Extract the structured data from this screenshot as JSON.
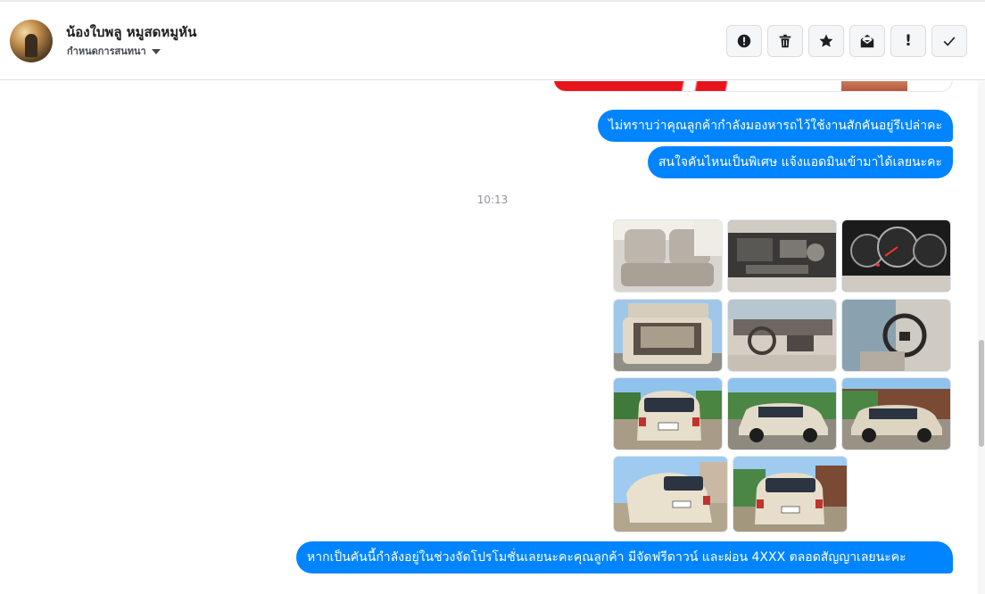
{
  "header": {
    "contact_name": "น้องใบพลู หมูสดหมูหัน",
    "sub_label": "กำหนดการสนทนา",
    "actions": [
      {
        "name": "report-spam-button",
        "icon": "alert-circle-icon"
      },
      {
        "name": "delete-button",
        "icon": "trash-icon"
      },
      {
        "name": "star-button",
        "icon": "star-icon"
      },
      {
        "name": "archive-button",
        "icon": "open-envelope-icon"
      },
      {
        "name": "mark-important-button",
        "icon": "exclamation-icon",
        "glyph": "!"
      },
      {
        "name": "mark-done-button",
        "icon": "check-icon"
      }
    ]
  },
  "messages": [
    {
      "text": "ไม่ทราบว่าคุณลูกค้ากำลังมองหารถไว้ใช้งานสักคันอยู่รึเปล่าคะ"
    },
    {
      "text": "สนใจคันไหนเป็นพิเศษ แจ้งแอดมินเข้ามาได้เลยนะคะ"
    }
  ],
  "timestamp": "10:13",
  "last_message": {
    "text": "หากเป็นคันนี้กำลังอยู่ในช่วงจัดโปรโมชั่นเลยนะคะคุณลูกค้า มีจัดฟรีดาวน์ และผ่อน 4XXX ตลอดสัญญาเลยนะคะ"
  },
  "photos": [
    {
      "name": "photo-rear-seats"
    },
    {
      "name": "photo-engine-bay"
    },
    {
      "name": "photo-gauge-cluster"
    },
    {
      "name": "photo-trunk-open"
    },
    {
      "name": "photo-dashboard"
    },
    {
      "name": "photo-steering-wheel"
    },
    {
      "name": "photo-car-rear"
    },
    {
      "name": "photo-car-side-left"
    },
    {
      "name": "photo-car-side-right"
    },
    {
      "name": "photo-car-rear-angle"
    },
    {
      "name": "photo-car-rear-driveway"
    }
  ],
  "colors": {
    "bubble": "#0084ff",
    "bubble_text": "#ffffff",
    "timestamp": "#90949c"
  }
}
